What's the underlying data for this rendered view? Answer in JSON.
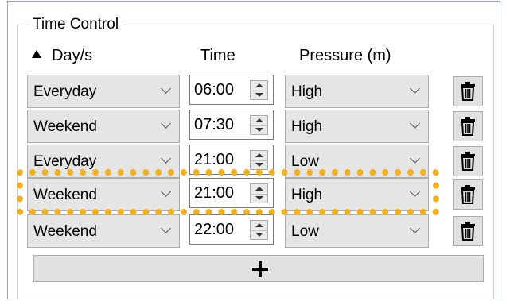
{
  "group": {
    "title": "Time Control"
  },
  "columns": {
    "day": "Day/s",
    "time": "Time",
    "pressure": "Pressure (m)"
  },
  "rows": [
    {
      "day": "Everyday",
      "time": "06:00",
      "pressure": "High"
    },
    {
      "day": "Weekend",
      "time": "07:30",
      "pressure": "High"
    },
    {
      "day": "Everyday",
      "time": "21:00",
      "pressure": "Low"
    },
    {
      "day": "Weekend",
      "time": "21:00",
      "pressure": "High"
    },
    {
      "day": "Weekend",
      "time": "22:00",
      "pressure": "Low"
    }
  ],
  "highlight": {
    "row_index": 3,
    "color": "#f2b11a"
  },
  "icons": {
    "delete": "trash-icon",
    "add": "plus-icon",
    "sort": "sort-up-icon"
  }
}
